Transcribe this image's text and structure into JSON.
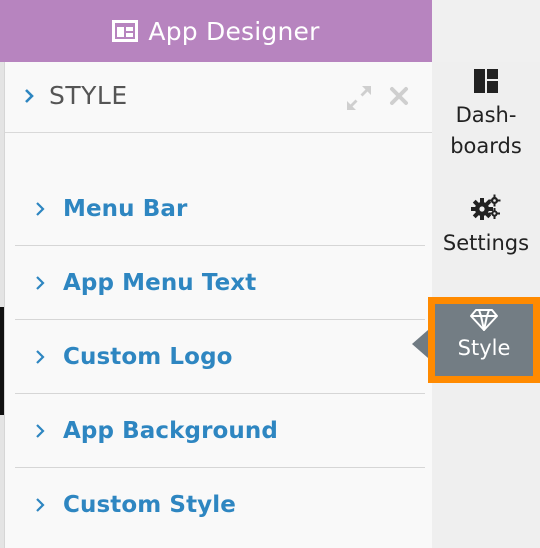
{
  "header": {
    "title": "App Designer",
    "icon": "app-layout-icon"
  },
  "panel": {
    "title": "STYLE",
    "icons": {
      "expand": "expand-icon",
      "close": "close-icon"
    },
    "items": [
      {
        "label": "Menu Bar"
      },
      {
        "label": "App Menu Text"
      },
      {
        "label": "Custom Logo"
      },
      {
        "label": "App Background"
      },
      {
        "label": "Custom Style"
      }
    ]
  },
  "nav": {
    "dashboards": {
      "line1": "Dash-",
      "line2": "boards",
      "icon": "dashboard-icon"
    },
    "settings": {
      "label": "Settings",
      "icon": "gears-icon"
    },
    "style": {
      "label": "Style",
      "icon": "diamond-icon"
    }
  },
  "colors": {
    "title_bar": "#b784bf",
    "link": "#2e86c1",
    "active_nav": "#737d84",
    "highlight": "#ff8a00"
  }
}
